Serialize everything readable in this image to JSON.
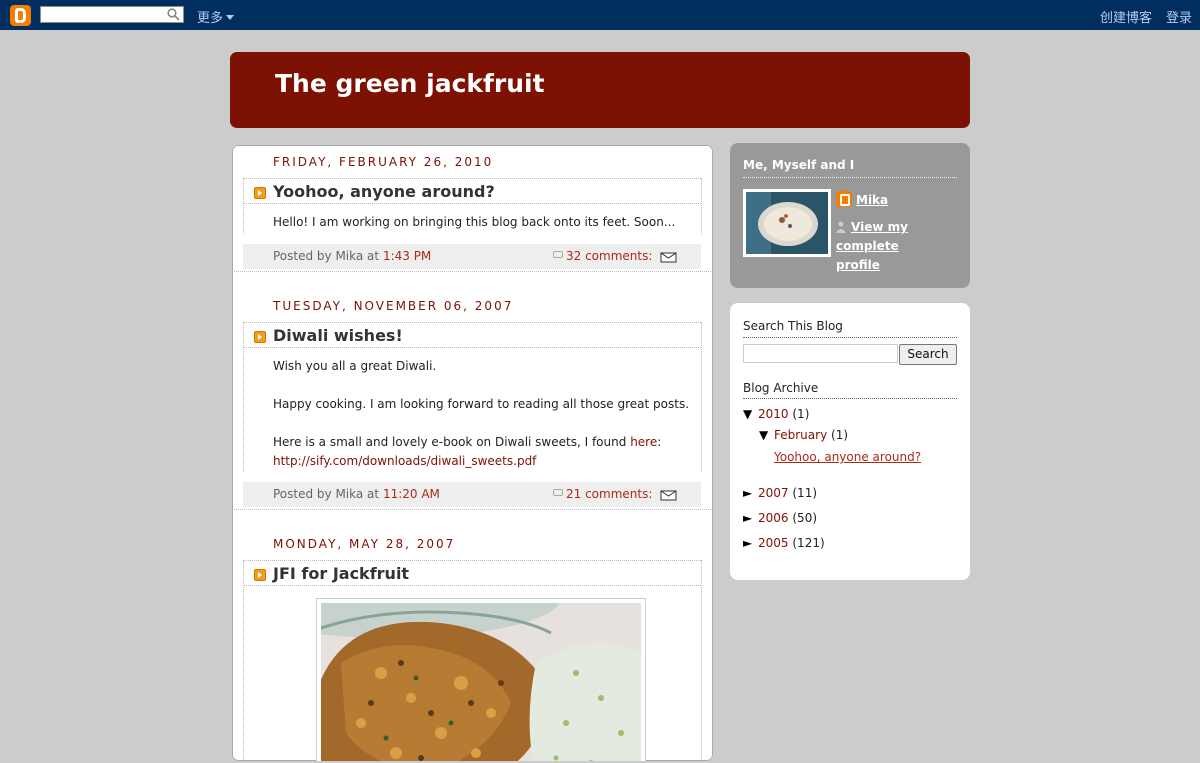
{
  "navbar": {
    "more_label": "更多",
    "create_blog_label": "创建博客",
    "login_label": "登录",
    "search_value": ""
  },
  "header": {
    "title": "The green jackfruit"
  },
  "posts": [
    {
      "date": "Friday, February 26, 2010",
      "title": "Yoohoo, anyone around?",
      "body": [
        "Hello! I am working on bringing this blog back onto its feet. Soon..."
      ],
      "posted_by": "Posted by Mika at",
      "time": "1:43 PM",
      "comments": "32 comments:"
    },
    {
      "date": "Tuesday, November 06, 2007",
      "title": "Diwali wishes!",
      "body": [
        "Wish you all a great Diwali.",
        "Happy cooking. I am looking forward to reading all those great posts.",
        "Here is a small and lovely e-book on Diwali sweets, I found"
      ],
      "link_here": "here",
      "url_text": "http://sify.com/downloads/diwali_sweets.pdf",
      "posted_by": "Posted by Mika at",
      "time": "11:20 AM",
      "comments": "21 comments:"
    },
    {
      "date": "Monday, May 28, 2007",
      "title": "JFI for Jackfruit"
    }
  ],
  "sidebar": {
    "profile_title": "Me, Myself and I",
    "profile_name": "Mika",
    "profile_link": "View my complete profile",
    "search_title": "Search This Blog",
    "search_button": "Search",
    "search_value": "",
    "archive_title": "Blog Archive",
    "archive": [
      {
        "year": "2010",
        "count": "(1)",
        "expanded": true
      },
      {
        "month": "February",
        "count": "(1)"
      },
      {
        "post": "Yoohoo, anyone around?"
      },
      {
        "year": "2007",
        "count": "(11)"
      },
      {
        "year": "2006",
        "count": "(50)"
      },
      {
        "year": "2005",
        "count": "(121)"
      }
    ]
  },
  "colors": {
    "navbar": "#002e5f",
    "header": "#7c1104",
    "profile_box": "#999999",
    "accent_link": "#aa2a1a",
    "background": "#cccccc"
  },
  "icons": [
    "blogger-logo-icon",
    "search-icon",
    "caret-down-icon",
    "post-bullet-icon",
    "comment-icon",
    "email-post-icon",
    "person-icon",
    "triangle-down-icon",
    "triangle-right-icon"
  ]
}
